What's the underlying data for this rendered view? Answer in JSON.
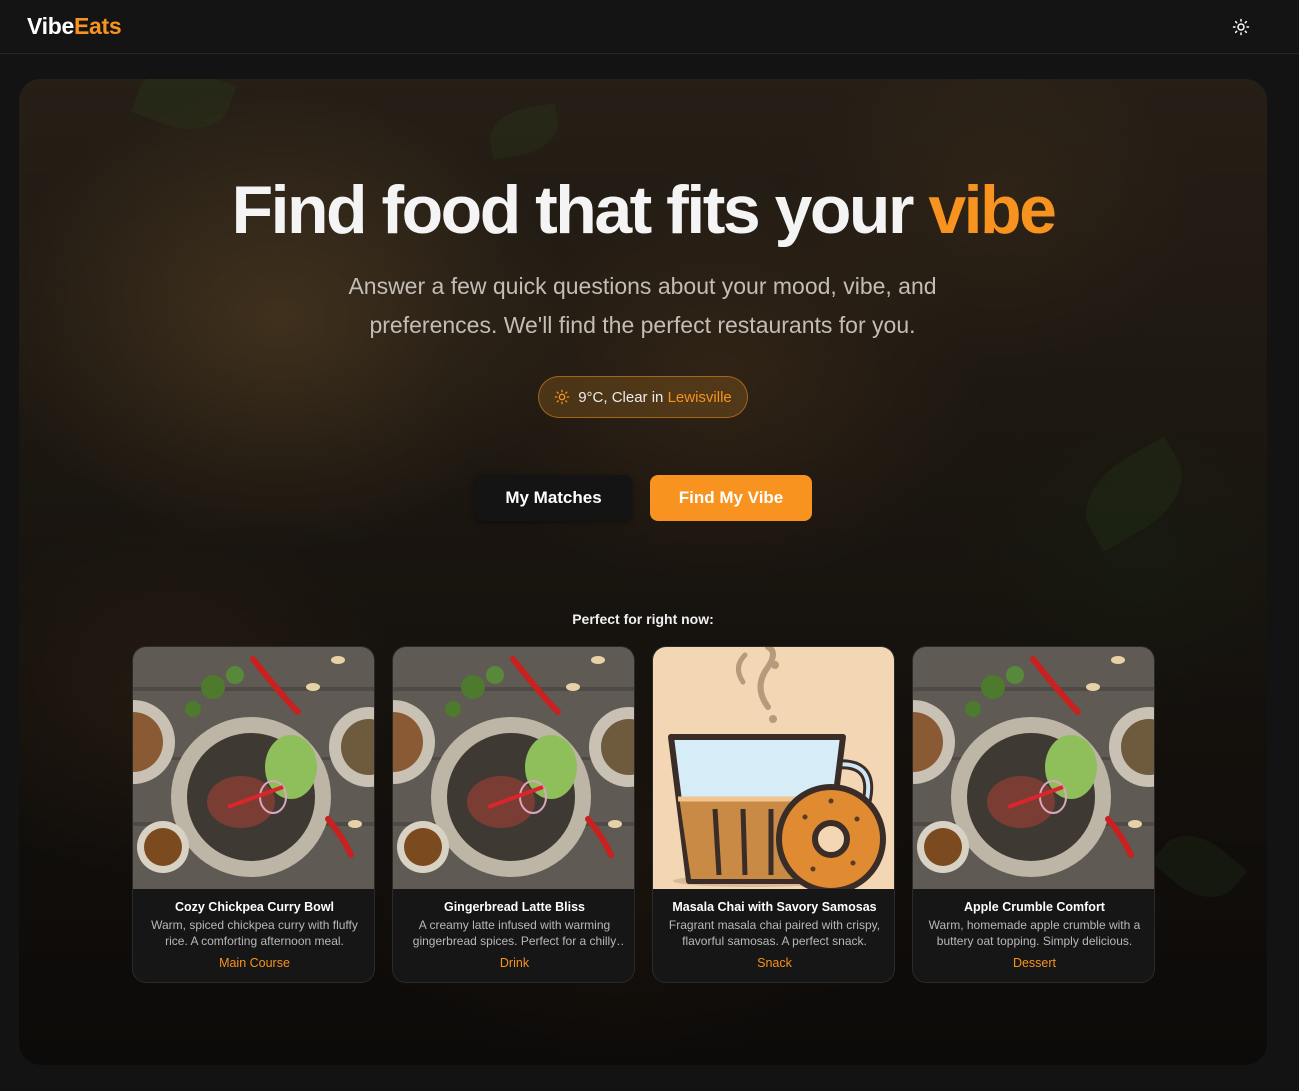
{
  "brand": {
    "part1": "Vibe",
    "part2": "Eats"
  },
  "header": {
    "theme_icon": "sun-icon"
  },
  "hero": {
    "headline_main": "Find food that fits your ",
    "headline_accent": "vibe",
    "subtitle": "Answer a few quick questions about your mood, vibe, and preferences. We'll find the perfect restaurants for you.",
    "weather": {
      "icon": "sun-icon",
      "text": "9°C, Clear in ",
      "location": "Lewisville"
    },
    "buttons": {
      "matches": "My Matches",
      "find": "Find My Vibe"
    },
    "section_label": "Perfect for right now:"
  },
  "cards": [
    {
      "title": "Cozy Chickpea Curry Bowl",
      "description": "Warm, spiced chickpea curry with fluffy rice. A comforting afternoon meal.",
      "category": "Main Course",
      "image": "food-plate-photo"
    },
    {
      "title": "Gingerbread Latte Bliss",
      "description": "A creamy latte infused with warming gingerbread spices. Perfect for a chilly day.",
      "category": "Drink",
      "image": "food-plate-photo"
    },
    {
      "title": "Masala Chai with Savory Samosas",
      "description": "Fragrant masala chai paired with crispy, flavorful samosas. A perfect snack.",
      "category": "Snack",
      "image": "chai-illustration"
    },
    {
      "title": "Apple Crumble Comfort",
      "description": "Warm, homemade apple crumble with a buttery oat topping. Simply delicious.",
      "category": "Dessert",
      "image": "food-plate-photo"
    }
  ],
  "colors": {
    "accent": "#f7931e",
    "background": "#131313",
    "card": "#161616"
  }
}
